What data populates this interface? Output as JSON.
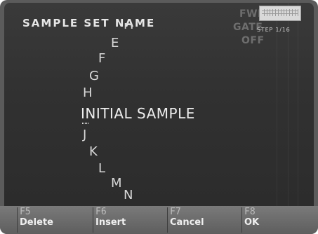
{
  "screen": {
    "title": "SAMPLE SET NAME",
    "ghost_labels": [
      "FWD",
      "GATE",
      "OFF"
    ],
    "step_label": "STEP 1/16",
    "keyboard_icon": "keyboard-icon",
    "letters_above": [
      "D",
      "E",
      "F",
      "G",
      "H"
    ],
    "selected_name": "INITIAL SAMPLE",
    "letters_below": [
      "J",
      "K",
      "L",
      "M",
      "N"
    ]
  },
  "function_keys": [
    {
      "key": "F5",
      "label": "Delete"
    },
    {
      "key": "F6",
      "label": "Insert"
    },
    {
      "key": "F7",
      "label": "Cancel"
    },
    {
      "key": "F8",
      "label": "OK"
    }
  ],
  "colors": {
    "background": "#333333",
    "text": "#e0e0e0",
    "function_bar": "#6a6a6a"
  }
}
